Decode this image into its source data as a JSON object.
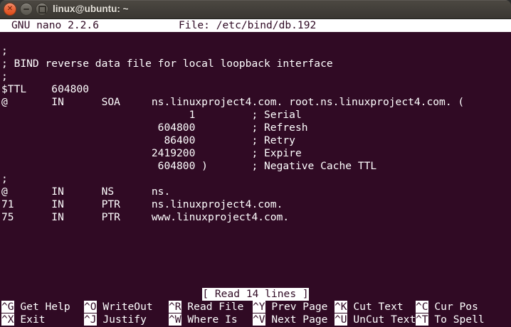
{
  "window": {
    "title": "linux@ubuntu: ~",
    "controls": {
      "close": "close-icon",
      "minimize": "minimize-icon",
      "maximize": "maximize-icon"
    },
    "close_glyph": "✕"
  },
  "nano": {
    "header": {
      "version": "GNU nano 2.2.6",
      "file": "File: /etc/bind/db.192"
    },
    "buffer_rows": [
      "",
      ";",
      "; BIND reverse data file for local loopback interface",
      ";",
      "$TTL\t604800",
      "@\tIN\tSOA\tns.linuxproject4.com. root.ns.linuxproject4.com. (",
      "\t\t\t      1\t\t; Serial",
      "\t\t\t 604800\t\t; Refresh",
      "\t\t\t  86400\t\t; Retry",
      "\t\t\t2419200\t\t; Expire",
      "\t\t\t 604800 )\t; Negative Cache TTL",
      ";",
      "@\tIN\tNS\tns.",
      "71\tIN\tPTR\tns.linuxproject4.com.",
      "75\tIN\tPTR\twww.linuxproject4.com."
    ],
    "status": "[ Read 14 lines ]",
    "shortcuts_row1": [
      {
        "key": "^G",
        "label": "Get Help"
      },
      {
        "key": "^O",
        "label": "WriteOut"
      },
      {
        "key": "^R",
        "label": "Read File"
      },
      {
        "key": "^Y",
        "label": "Prev Page"
      },
      {
        "key": "^K",
        "label": "Cut Text"
      },
      {
        "key": "^C",
        "label": "Cur Pos"
      }
    ],
    "shortcuts_row2": [
      {
        "key": "^X",
        "label": "Exit"
      },
      {
        "key": "^J",
        "label": "Justify"
      },
      {
        "key": "^W",
        "label": "Where Is"
      },
      {
        "key": "^V",
        "label": "Next Page"
      },
      {
        "key": "^U",
        "label": "UnCut Text"
      },
      {
        "key": "^T",
        "label": "To Spell"
      }
    ]
  },
  "colors": {
    "terminal_bg": "#300a24",
    "terminal_fg": "#ffffff",
    "reverse_bg": "#ffffff",
    "reverse_fg": "#300a24",
    "titlebar_top": "#4c4842",
    "titlebar_bottom": "#3a3732",
    "close_button": "#dc4a18"
  }
}
